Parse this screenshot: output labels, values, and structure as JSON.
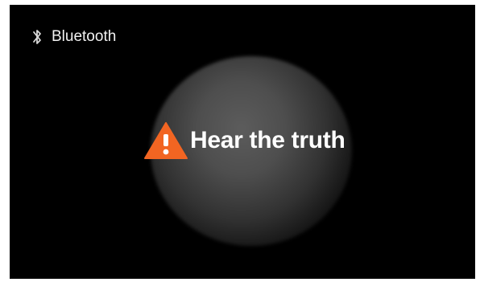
{
  "header": {
    "icon": "bluetooth-icon",
    "label": "Bluetooth"
  },
  "headline": {
    "icon": "warning-triangle-icon",
    "icon_color": "#f26522",
    "text": "Hear the truth"
  },
  "colors": {
    "background": "#000000",
    "text": "#ffffff",
    "accent": "#f26522"
  }
}
